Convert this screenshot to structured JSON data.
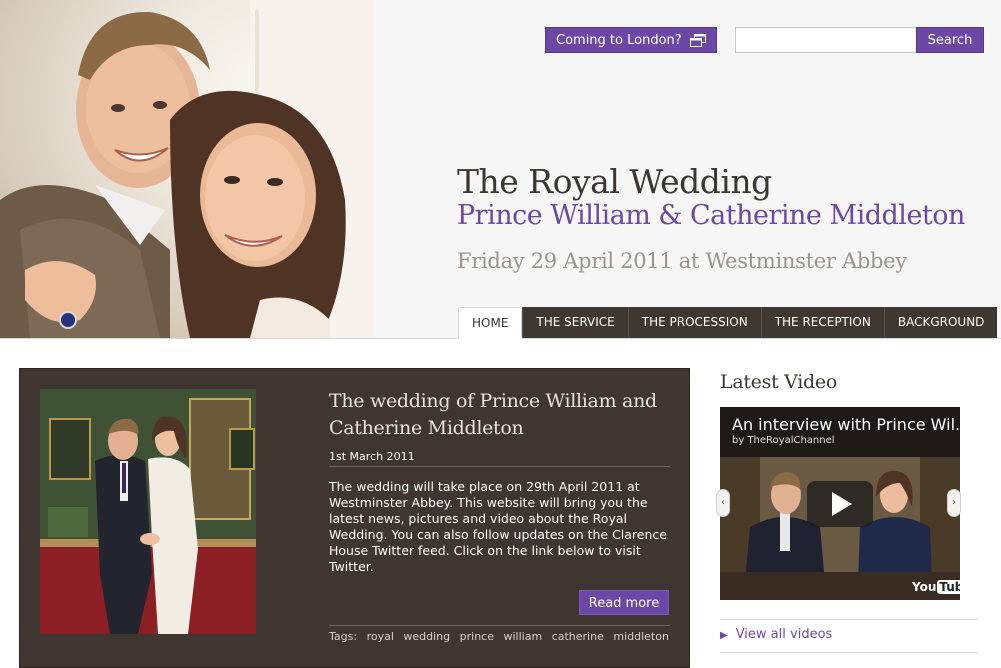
{
  "header": {
    "coming_to_london": "Coming to London?",
    "search_button": "Search",
    "search_placeholder": "",
    "title": "The Royal Wedding",
    "subtitle": "Prince William & Catherine Middleton",
    "date_line": "Friday 29 April 2011 at Westminster Abbey"
  },
  "nav": {
    "tabs": [
      {
        "label": "HOME",
        "active": true
      },
      {
        "label": "THE SERVICE",
        "active": false
      },
      {
        "label": "THE PROCESSION",
        "active": false
      },
      {
        "label": "THE RECEPTION",
        "active": false
      },
      {
        "label": "BACKGROUND",
        "active": false
      }
    ]
  },
  "feature": {
    "title": "The wedding of Prince William and Catherine Middleton",
    "date": "1st March 2011",
    "body": "The wedding will take place on 29th April 2011 at Westminster Abbey. This website will bring you the latest news, pictures and video about the Royal Wedding. You can also follow updates on the Clarence House Twitter feed. Click on the link below to visit Twitter.",
    "read_more": "Read more",
    "tags_label": "Tags:",
    "tags": [
      "royal",
      "wedding",
      "prince",
      "william",
      "catherine",
      "middleton"
    ]
  },
  "sidebar": {
    "heading": "Latest Video",
    "video_title": "An interview with Prince Wil...",
    "video_by": "by TheRoyalChannel",
    "youtube_logo": "You",
    "youtube_logo_tube": "Tube",
    "view_all": "View all videos"
  },
  "colors": {
    "accent_purple": "#6b48a6",
    "dark_brown": "#3f3631",
    "header_bg": "#f6f6f6"
  },
  "icons": {
    "external_window": "external-window-icon",
    "play": "play-icon",
    "left": "chevron-left-icon",
    "right": "chevron-right-icon",
    "view_all_arrow": "triangle-right-icon"
  }
}
